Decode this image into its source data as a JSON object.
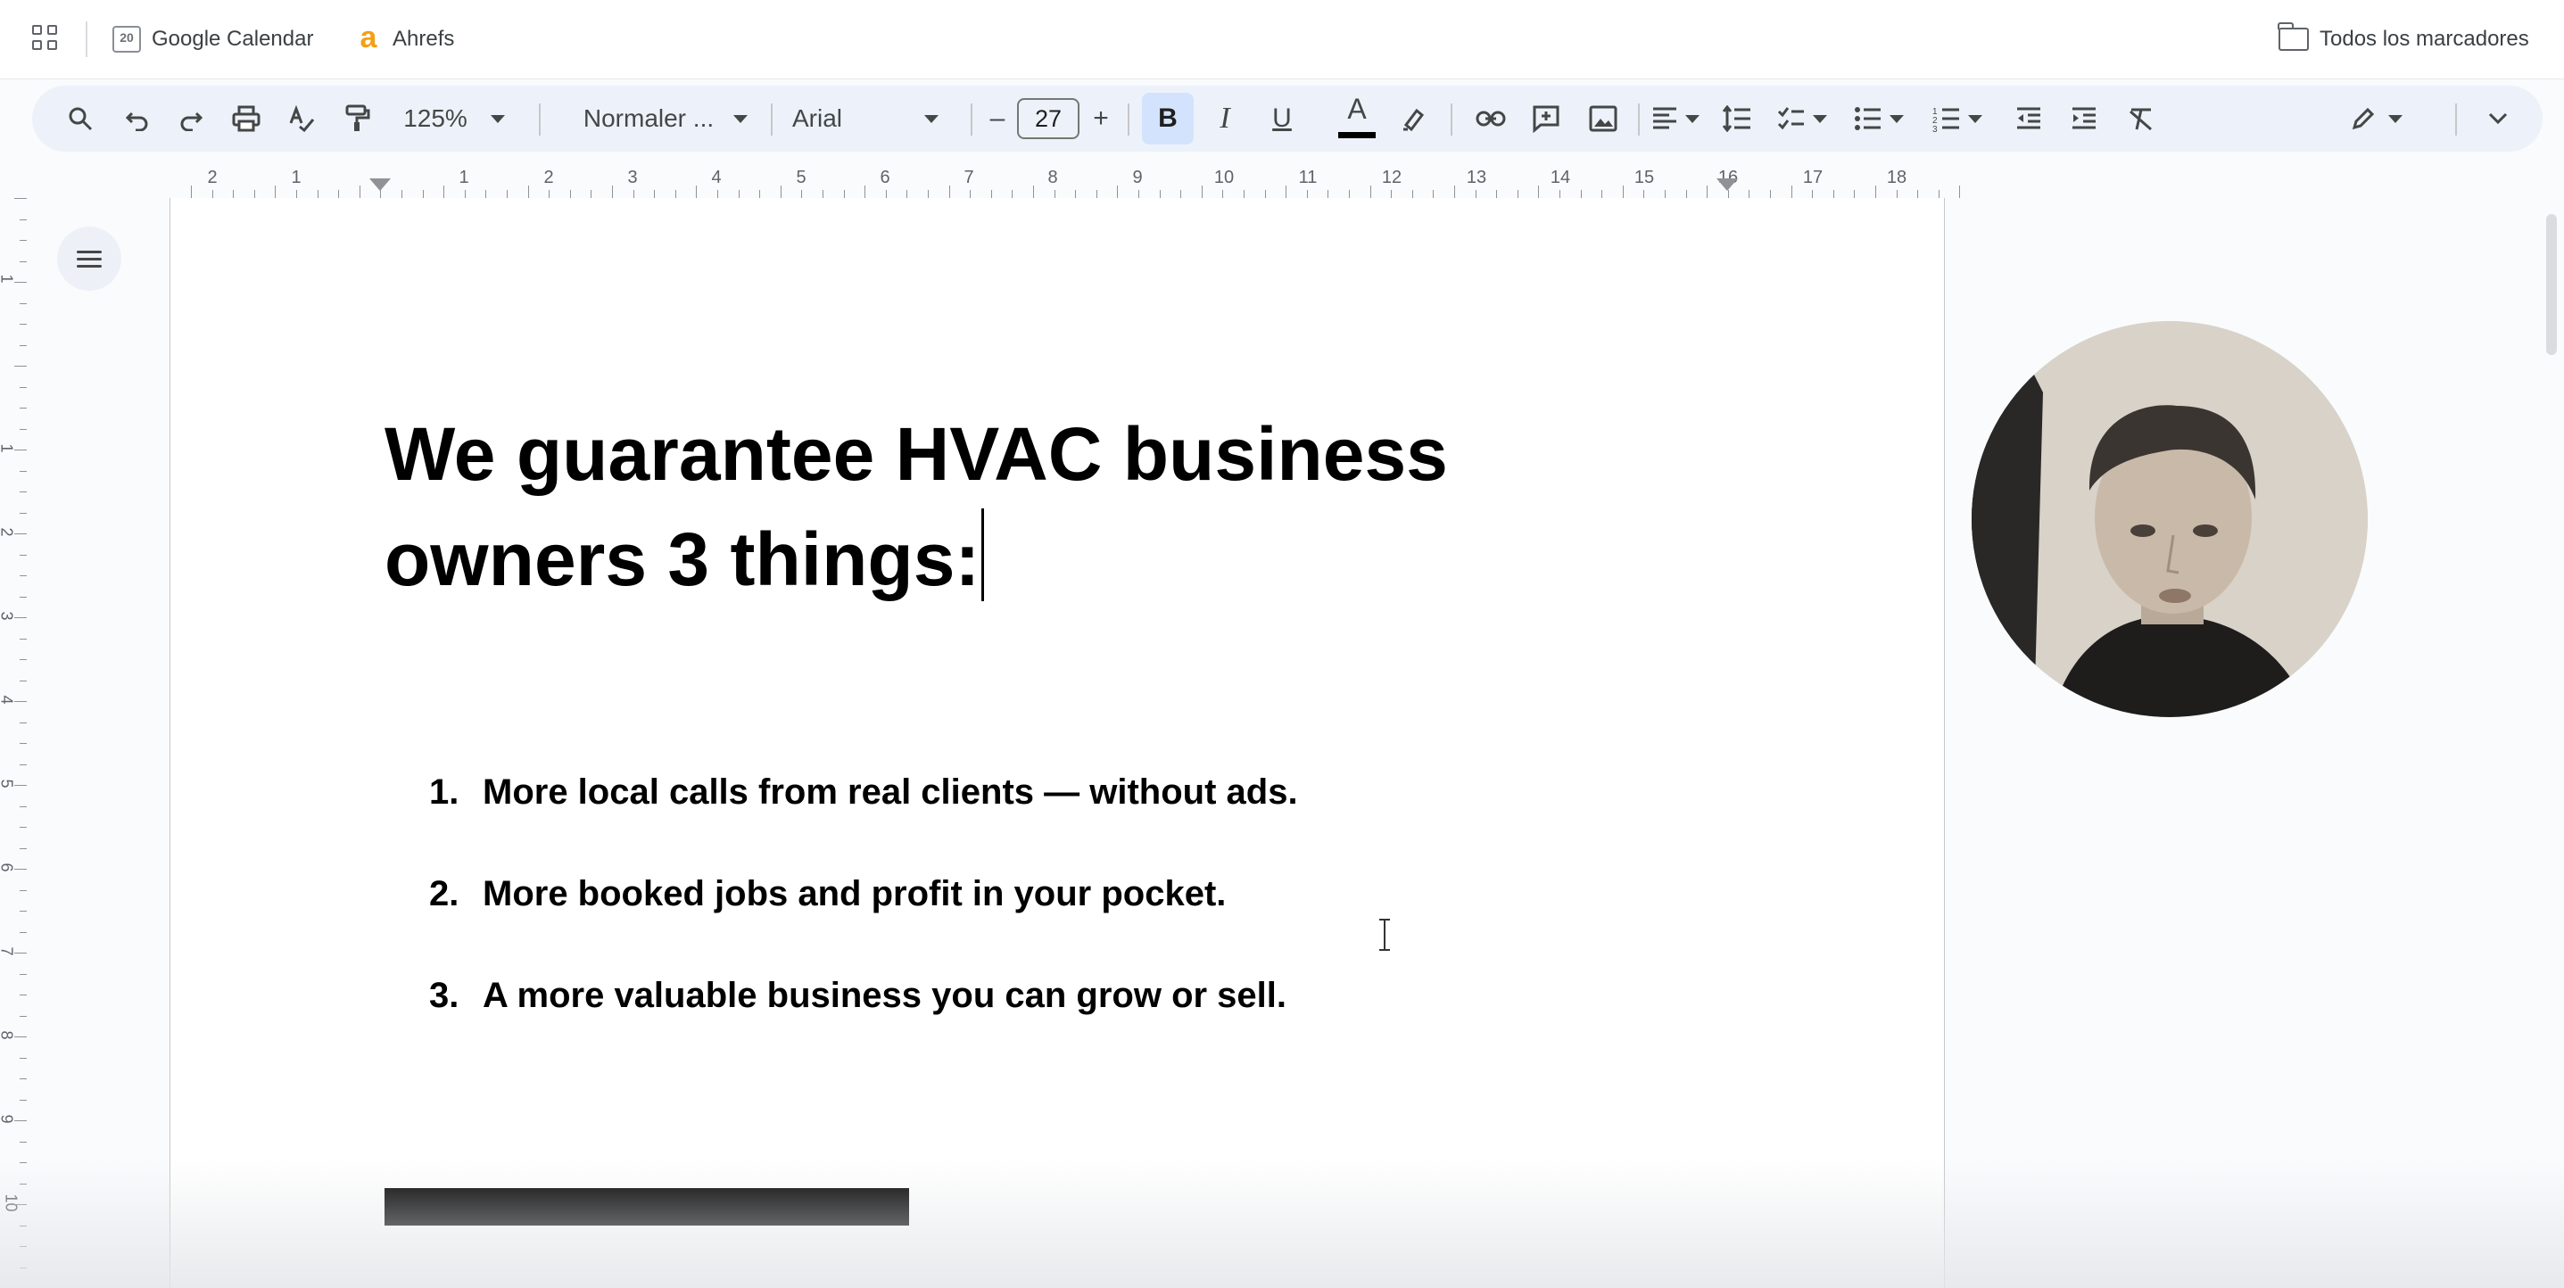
{
  "bookmarks_bar": {
    "items": [
      {
        "label": "Google Calendar",
        "icon": "calendar-icon",
        "icon_text": "20"
      },
      {
        "label": "Ahrefs",
        "icon": "ahrefs-icon",
        "icon_text": "a"
      }
    ],
    "all_bookmarks_label": "Todos los marcadores"
  },
  "toolbar": {
    "zoom": "125%",
    "style": "Normaler ...",
    "font": "Arial",
    "font_size": "27",
    "minus": "–",
    "plus": "+",
    "bold": "B",
    "italic": "I",
    "underline": "U",
    "text_color": "A"
  },
  "ruler": {
    "numbers": [
      "2",
      "1",
      "1",
      "2",
      "3",
      "4",
      "5",
      "6",
      "7",
      "8",
      "9",
      "10",
      "11",
      "12",
      "13",
      "14",
      "15",
      "16",
      "17",
      "18"
    ]
  },
  "vruler": {
    "numbers": [
      "1",
      "1",
      "2",
      "3",
      "4",
      "5",
      "6",
      "7",
      "8",
      "9",
      "10"
    ]
  },
  "document": {
    "heading": "We guarantee HVAC business owners 3 things:",
    "list": [
      {
        "number": "1.",
        "text": "More local calls from real clients — without ads."
      },
      {
        "number": "2.",
        "text": "More booked jobs and profit in your pocket."
      },
      {
        "number": "3.",
        "text": "A more valuable business you can grow or sell."
      }
    ]
  }
}
